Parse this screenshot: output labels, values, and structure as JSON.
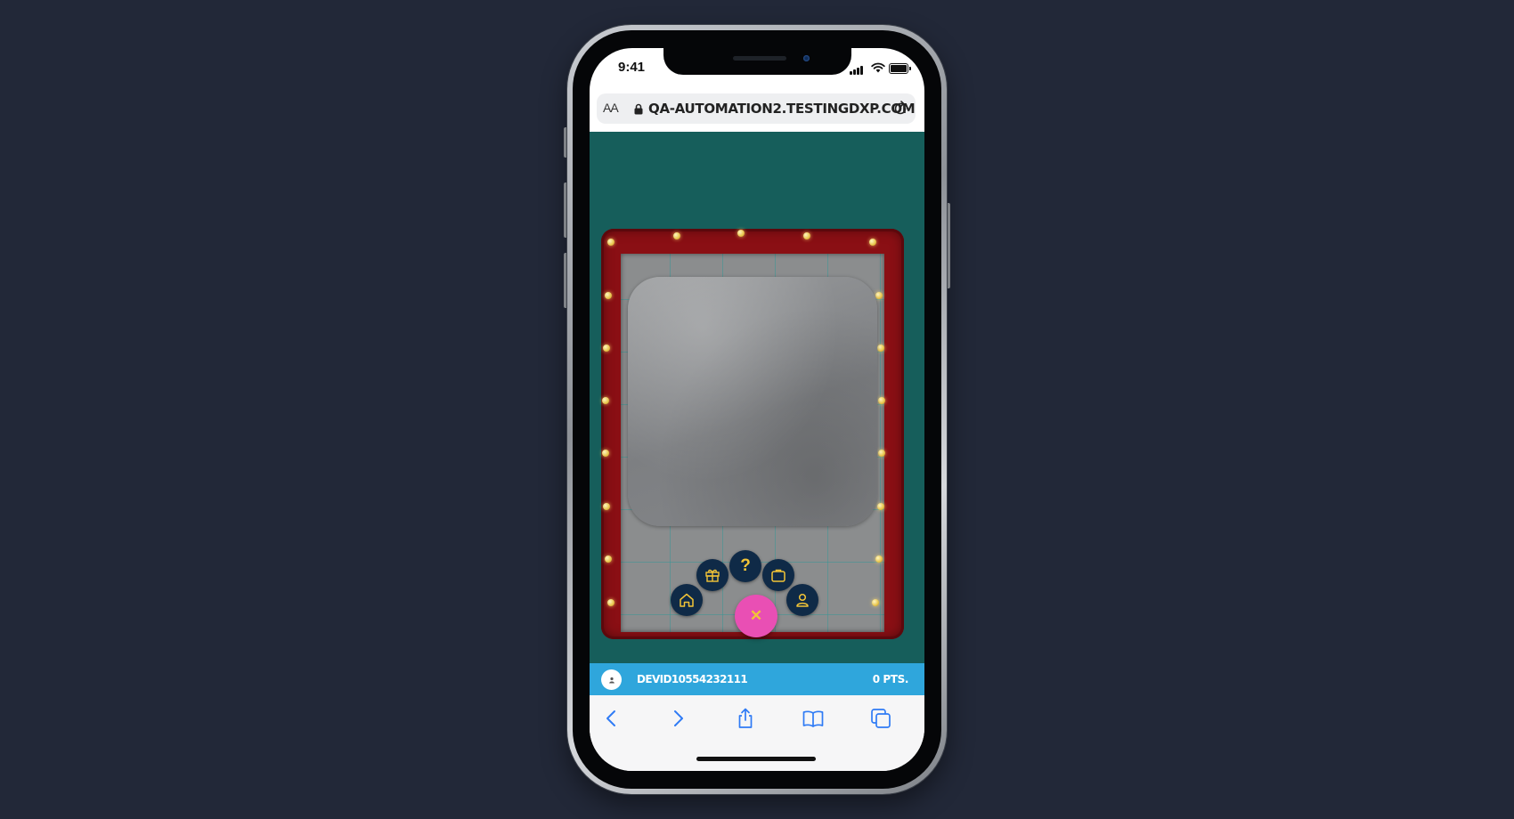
{
  "status_bar": {
    "time": "9:41"
  },
  "browser": {
    "text_size_label": "AA",
    "url": "QA-AUTOMATION2.TESTINGDXP.COM"
  },
  "game": {
    "close_symbol": "✕",
    "help_symbol": "?",
    "menu_items": [
      "home-icon",
      "gift-icon",
      "help-icon",
      "briefcase-icon",
      "profile-icon"
    ]
  },
  "user_bar": {
    "username": "DEVID10554232111",
    "points": "0 PTS."
  },
  "toolbar": {
    "items": [
      "back-icon",
      "forward-icon",
      "share-icon",
      "bookmarks-icon",
      "tabs-icon"
    ]
  },
  "colors": {
    "page_background": "#222838",
    "game_background": "#165e5b",
    "frame_red": "#8a0f14",
    "menu_navy": "#0f2a47",
    "icon_gold": "#f2c437",
    "fab_pink": "#e94fb4",
    "user_bar_blue": "#2fa6dc",
    "safari_blue": "#2f7bf5"
  }
}
